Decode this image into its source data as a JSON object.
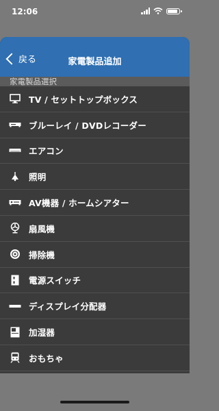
{
  "status": {
    "time": "12:06"
  },
  "nav": {
    "back_label": "戻る",
    "title": "家電製品追加"
  },
  "section": {
    "header": "家電製品選択"
  },
  "items": [
    {
      "label": "TV / セットトップボックス",
      "icon": "tv-icon"
    },
    {
      "label": "ブルーレイ / DVDレコーダー",
      "icon": "bluray-recorder-icon"
    },
    {
      "label": "エアコン",
      "icon": "air-conditioner-icon"
    },
    {
      "label": "照明",
      "icon": "light-icon"
    },
    {
      "label": "AV機器 / ホームシアター",
      "icon": "av-receiver-icon"
    },
    {
      "label": "扇風機",
      "icon": "fan-icon"
    },
    {
      "label": "掃除機",
      "icon": "vacuum-icon"
    },
    {
      "label": "電源スイッチ",
      "icon": "power-switch-icon"
    },
    {
      "label": "ディスプレイ分配器",
      "icon": "display-splitter-icon"
    },
    {
      "label": "加湿器",
      "icon": "humidifier-icon"
    },
    {
      "label": "おもちゃ",
      "icon": "toy-train-icon"
    }
  ],
  "colors": {
    "nav_bar": "#2f6fb2",
    "list_bg": "#3b3b3b",
    "section_bg": "#5b5b5b",
    "backdrop": "#7a7a7a"
  }
}
